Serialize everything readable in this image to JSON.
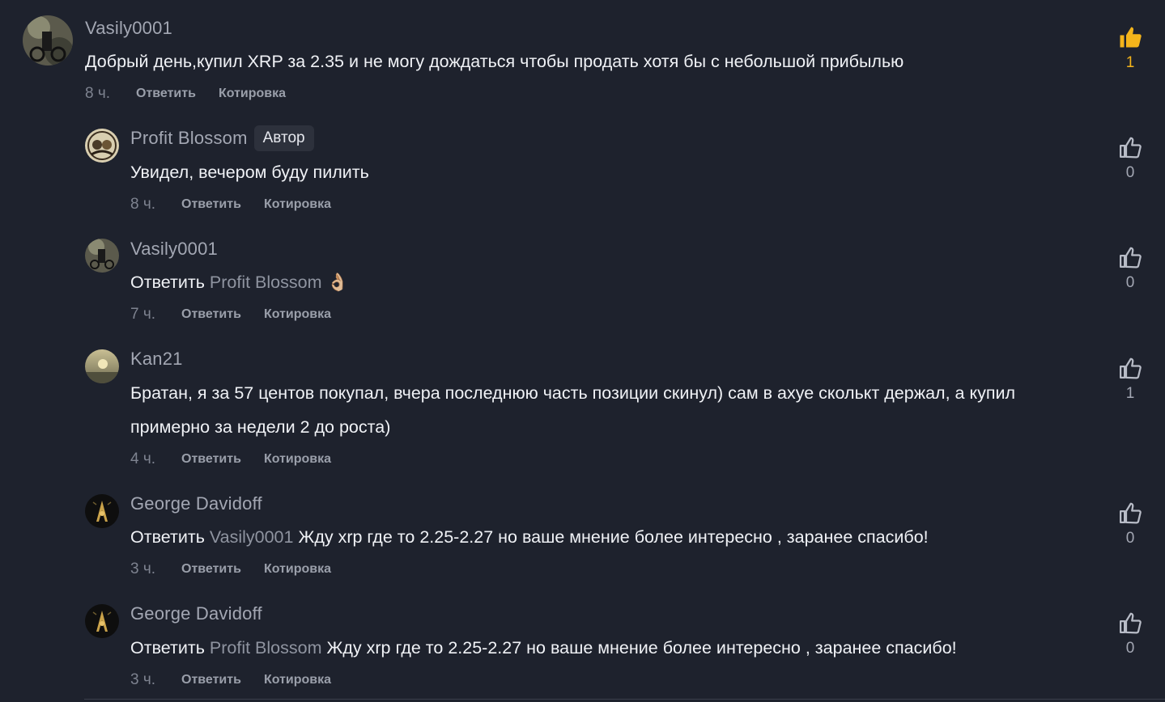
{
  "comments": [
    {
      "author": "Vasily0001",
      "text": "Добрый день,купил XRP за 2.35 и не могу дождаться чтобы продать хотя бы с небольшой прибылью",
      "time": "8 ч.",
      "reply_label": "Ответить",
      "quote_label": "Котировка",
      "likes": "1"
    },
    {
      "author": "Profit Blossom",
      "badge": "Автор",
      "text": "Увидел, вечером буду пилить",
      "time": "8 ч.",
      "reply_label": "Ответить",
      "quote_label": "Котировка",
      "likes": "0"
    },
    {
      "author": "Vasily0001",
      "reply_prefix": "Ответить",
      "mention": "Profit Blossom",
      "text": "👌🏼",
      "time": "7 ч.",
      "reply_label": "Ответить",
      "quote_label": "Котировка",
      "likes": "0"
    },
    {
      "author": "Kan21",
      "text": "Братан, я за 57 центов покупал, вчера последнюю часть позиции скинул) сам в ахуе сколькт держал, а купил примерно за недели 2 до роста)",
      "time": "4 ч.",
      "reply_label": "Ответить",
      "quote_label": "Котировка",
      "likes": "1"
    },
    {
      "author": "George Davidoff",
      "reply_prefix": "Ответить",
      "mention": "Vasily0001",
      "text": "Жду xrp где то 2.25-2.27 но ваше мнение более интересно , заранее спасибо!",
      "time": "3 ч.",
      "reply_label": "Ответить",
      "quote_label": "Котировка",
      "likes": "0"
    },
    {
      "author": "George Davidoff",
      "reply_prefix": "Ответить",
      "mention": "Profit Blossom",
      "text": "Жду xrp где то 2.25-2.27 но ваше мнение более интересно , заранее спасибо!",
      "time": "3 ч.",
      "reply_label": "Ответить",
      "quote_label": "Котировка",
      "likes": "0"
    }
  ],
  "icons": {
    "like_active": "thumbs-up-filled-icon",
    "like": "thumbs-up-outline-icon"
  },
  "colors": {
    "background": "#1e222d",
    "like_active": "#f3b41b",
    "mention": "#8f94a0"
  }
}
